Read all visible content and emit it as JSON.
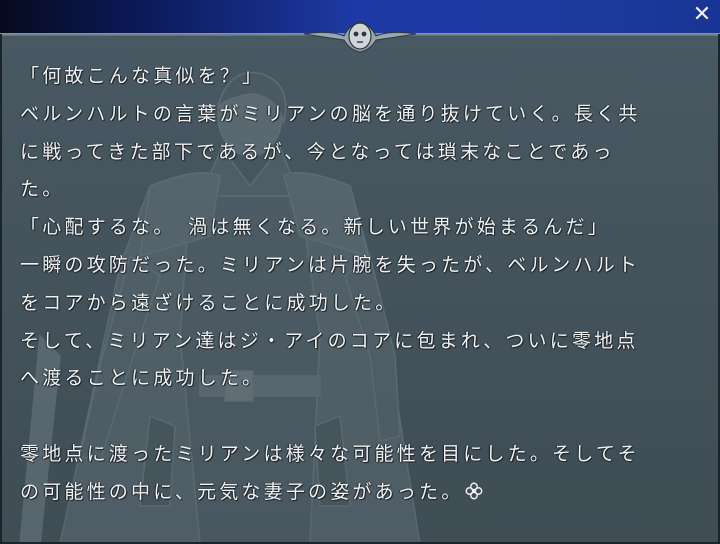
{
  "window": {
    "close_label": "✕"
  },
  "colors": {
    "titlebar_accent": "#1e3aa6",
    "background": "#44535c",
    "text": "#f0f2f4"
  },
  "message": {
    "lines": [
      "「何故こんな真似を？」",
      "ベルンハルトの言葉がミリアンの脳を通り抜けていく。長く共",
      "に戦ってきた部下であるが、今となっては瑣末なことであっ",
      "た。",
      "「心配するな。　渦は無くなる。新しい世界が始まるんだ」",
      "一瞬の攻防だった。ミリアンは片腕を失ったが、ベルンハルト",
      "をコアから遠ざけることに成功した。",
      "そして、ミリアン達はジ・アイのコアに包まれ、ついに零地点",
      "へ渡ることに成功した。",
      "",
      "零地点に渡ったミリアンは様々な可能性を目にした。そしてそ",
      "の可能性の中に、元気な妻子の姿があった。"
    ]
  },
  "icons": {
    "page_wait": "clover-cursor-icon",
    "crest": "skull-crest-icon"
  }
}
